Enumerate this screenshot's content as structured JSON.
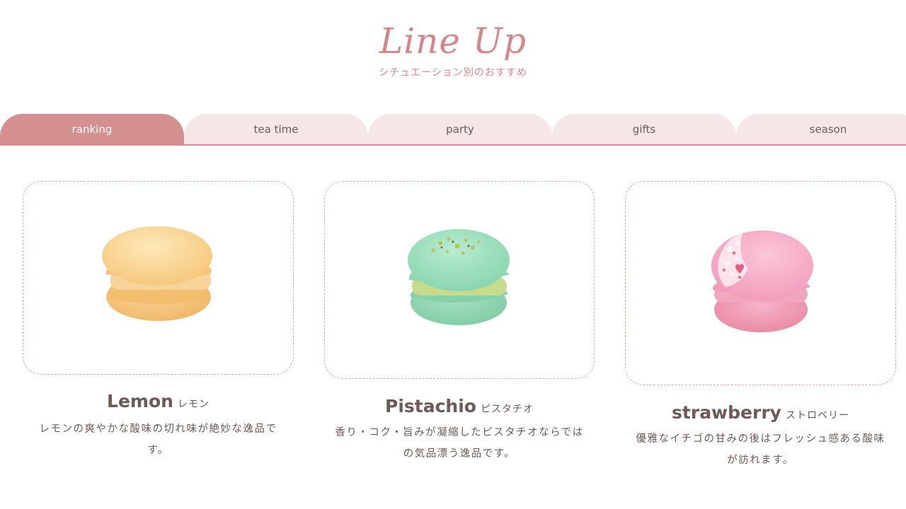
{
  "header": {
    "title": "Line Up",
    "subtitle": "シチュエーション別のおすすめ"
  },
  "tabs": [
    {
      "label": "ranking",
      "active": true
    },
    {
      "label": "tea time",
      "active": false
    },
    {
      "label": "party",
      "active": false
    },
    {
      "label": "gifts",
      "active": false
    },
    {
      "label": "season",
      "active": false
    }
  ],
  "products": [
    {
      "name": "Lemon",
      "kana": "レモン",
      "desc_line1": "レモンの爽やかな酸味の切れ味が絶妙な逸品で",
      "desc_line2": "す。",
      "image": "lemon-macaron"
    },
    {
      "name": "Pistachio",
      "kana": "ピスタチオ",
      "desc_line1": "香り・コク・旨みが凝縮したピスタチオならでは",
      "desc_line2": "の気品漂う逸品です。",
      "image": "pistachio-macaron"
    },
    {
      "name": "strawberry",
      "kana": "ストロベリー",
      "desc_line1": "優雅なイチゴの甘みの後はフレッシュ感ある酸味",
      "desc_line2": "が訪れます。",
      "image": "strawberry-macaron"
    }
  ],
  "colors": {
    "accent": "#d4908f",
    "tab_inactive": "#f5e6e7",
    "text": "#6b5a55",
    "title": "#d4878a"
  }
}
